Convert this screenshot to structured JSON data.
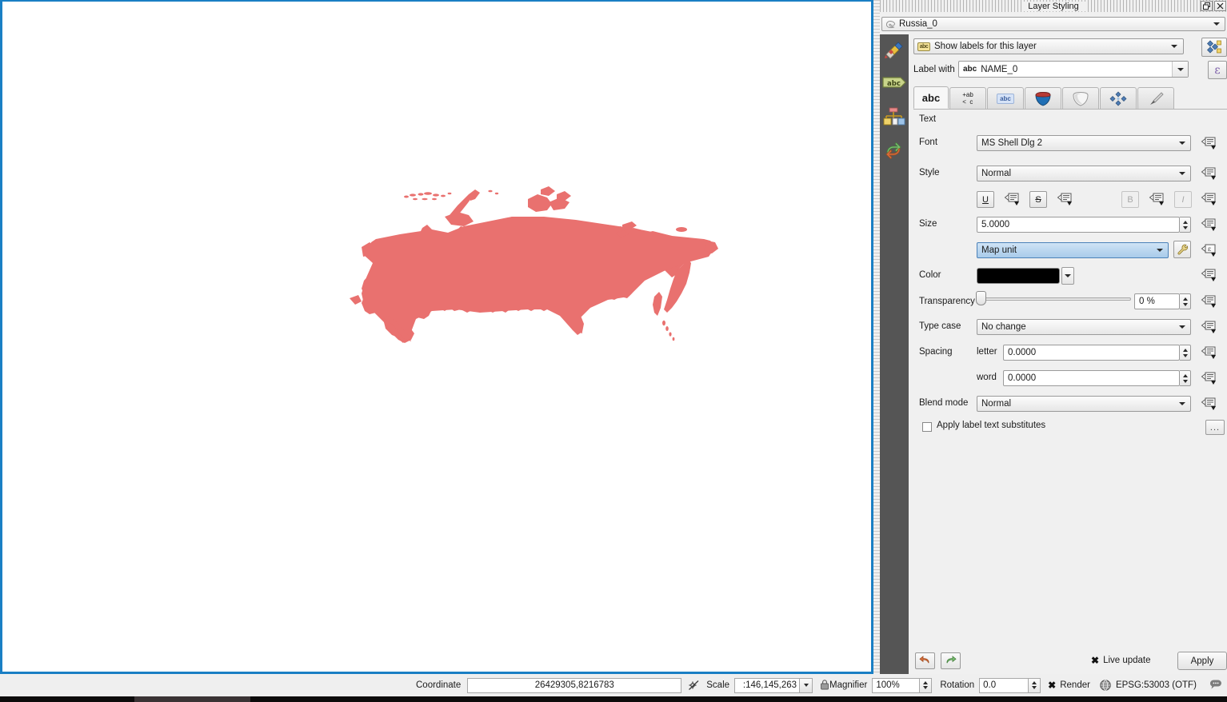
{
  "panel": {
    "title": "Layer Styling",
    "float_button": "❐",
    "close_button": "✕",
    "layer_name": "Russia_0",
    "labeling_mode": "Show labels for this layer",
    "label_with_label": "Label with",
    "label_field": "NAME_0",
    "expression_button": "ε",
    "rail": [
      {
        "name": "symbology",
        "tooltip": "Symbology"
      },
      {
        "name": "labels",
        "tooltip": "Labels"
      },
      {
        "name": "diagrams",
        "tooltip": "Diagrams"
      },
      {
        "name": "history",
        "tooltip": "History"
      }
    ],
    "tabs": [
      {
        "id": "text",
        "label": "abc",
        "icon": "text-abc-icon",
        "active": true
      },
      {
        "id": "formatting",
        "label": "+ab\n< c",
        "icon": "formatting-icon",
        "active": false
      },
      {
        "id": "buffer",
        "label": "abc",
        "icon": "buffer-abc-icon",
        "active": false
      },
      {
        "id": "background",
        "label": "",
        "icon": "background-shield-icon",
        "active": false
      },
      {
        "id": "shadow",
        "label": "",
        "icon": "shadow-shape-icon",
        "active": false
      },
      {
        "id": "placement",
        "label": "",
        "icon": "placement-diamond-icon",
        "active": false
      },
      {
        "id": "rendering",
        "label": "",
        "icon": "rendering-brush-icon",
        "active": false
      }
    ],
    "text_tab": {
      "section": "Text",
      "font_label": "Font",
      "font_value": "MS Shell Dlg 2",
      "style_label": "Style",
      "style_value": "Normal",
      "underline_button": "U",
      "strikethrough_button": "S",
      "bold_button": "B",
      "italic_button": "I",
      "size_label": "Size",
      "size_value": "5.0000",
      "unit_value": "Map unit",
      "color_label": "Color",
      "color_value": "#000000",
      "transparency_label": "Transparency",
      "transparency_value": "0 %",
      "type_case_label": "Type case",
      "type_case_value": "No change",
      "spacing_label": "Spacing",
      "spacing_letter_label": "letter",
      "spacing_letter_value": "0.0000",
      "spacing_word_label": "word",
      "spacing_word_value": "0.0000",
      "blend_mode_label": "Blend mode",
      "blend_mode_value": "Normal",
      "substitutes_label": "Apply label text substitutes",
      "substitutes_checked": false,
      "substitutes_button": "..."
    },
    "footer": {
      "undo_button": "↩",
      "redo_button": "↪",
      "live_update_label": "Live update",
      "live_update_checked": true,
      "apply_label": "Apply"
    }
  },
  "status_bar": {
    "coordinate_label": "Coordinate",
    "coordinate_value": "26429305,8216783",
    "scale_label": "Scale",
    "scale_value": ":146,145,263",
    "magnifier_label": "Magnifier",
    "magnifier_value": "100%",
    "rotation_label": "Rotation",
    "rotation_value": "0.0",
    "render_label": "Render",
    "render_checked": true,
    "crs_label": "EPSG:53003 (OTF)",
    "messages_icon": "messages-bubble-icon"
  },
  "map": {
    "feature_name": "Russia_0",
    "fill_color": "#e9716f",
    "background_color": "#ffffff",
    "canvas_focus_color": "#1a7fc4"
  }
}
